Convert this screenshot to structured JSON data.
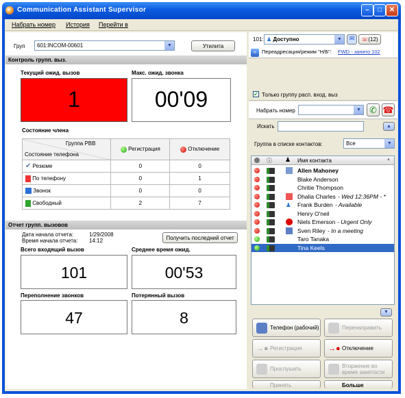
{
  "window": {
    "title": "Communication Assistant Supervisor"
  },
  "menu": [
    "Набрать номер",
    "История",
    "Перейти в"
  ],
  "group": {
    "label": "Груп",
    "value": "601:INCOM-00601",
    "utility_button": "Утилита"
  },
  "sections": {
    "control": "Контроль групп. выз.",
    "report": "Отчет групп. вызовов"
  },
  "current_wait": {
    "label": "Текущий ожид. вызов",
    "value": "1"
  },
  "max_wait": {
    "label": "Макс. ожид. звонка",
    "value": "00'09"
  },
  "member_status": {
    "title": "Состояние члена",
    "header_group": "Группа PBB",
    "header_phone": "Состояние телефона",
    "col_registration": "Регистрация",
    "col_logout": "Отключение",
    "rows": [
      {
        "label": "Резюме",
        "reg": "0",
        "out": "0"
      },
      {
        "label": "По телефону",
        "reg": "0",
        "out": "1"
      },
      {
        "label": "Звонок",
        "reg": "0",
        "out": "0"
      },
      {
        "label": "Свободный",
        "reg": "2",
        "out": "7"
      }
    ]
  },
  "report": {
    "start_date_label": "Дата начала отчета:",
    "start_date": "1/29/2008",
    "start_time_label": "Время начала отчета:",
    "start_time": "14:12",
    "refresh_button": "Получить последний отчет",
    "total_incoming": {
      "label": "Всего входящий вызов",
      "value": "101"
    },
    "avg_wait": {
      "label": "Среднее время ожид.",
      "value": "00'53"
    },
    "overflow": {
      "label": "Переполнение звонков",
      "value": "47"
    },
    "lost": {
      "label": "Потерянный вызов",
      "value": "8"
    }
  },
  "status_panel": {
    "extension": "101:",
    "status": "Доступно",
    "missed_count": "(12)",
    "forward_label": "Переадресация/режим \"Н/Б\":",
    "forward_value": "FWD - занято 102"
  },
  "only_group_checkbox": "Только группу расп. вход. выз",
  "dial": {
    "label": "Набрать номер"
  },
  "search": {
    "label": "Искать"
  },
  "contact_group": {
    "label": "Группа в списке контактов:",
    "value": "Все"
  },
  "contacts_header": "Имя контакта",
  "contacts": [
    {
      "name": "Allen Mahoney",
      "note": "",
      "presence": "red",
      "bold": true,
      "status_icon": "pc-icon"
    },
    {
      "name": "Blake Anderson",
      "note": "",
      "presence": "red",
      "bold": false,
      "status_icon": ""
    },
    {
      "name": "Chritie Thompson",
      "note": "",
      "presence": "red",
      "bold": false,
      "status_icon": ""
    },
    {
      "name": "Dhalia Charles",
      "note": "- Wed 12:36PM - *",
      "presence": "red",
      "bold": false,
      "status_icon": "phone-busy-icon"
    },
    {
      "name": "Frank Burden",
      "note": "- Available",
      "presence": "red",
      "bold": false,
      "status_icon": "person-icon"
    },
    {
      "name": "Henry O'neil",
      "note": "",
      "presence": "red",
      "bold": false,
      "status_icon": ""
    },
    {
      "name": "Niels Emerson",
      "note": "- Urgent Only",
      "presence": "red",
      "bold": false,
      "status_icon": "urgent-icon"
    },
    {
      "name": "Sven Riley",
      "note": "- In a meeting",
      "presence": "red",
      "bold": false,
      "status_icon": "meeting-icon"
    },
    {
      "name": "Taro Tanaka",
      "note": "",
      "presence": "green",
      "bold": false,
      "status_icon": ""
    },
    {
      "name": "Tina Keels",
      "note": "",
      "presence": "green",
      "bold": false,
      "status_icon": "",
      "selected": true
    }
  ],
  "actions": [
    {
      "label": "Телефон (рабочий)",
      "enabled": true
    },
    {
      "label": "Перенаправить",
      "enabled": false
    },
    {
      "label": "Регистрация",
      "enabled": false
    },
    {
      "label": "Отключение",
      "enabled": true
    },
    {
      "label": "Прослушать",
      "enabled": false
    },
    {
      "label": "Вторжение во время занятости",
      "enabled": false
    },
    {
      "label": "Принять",
      "enabled": false
    },
    {
      "label": "Больше",
      "enabled": true
    }
  ],
  "colors": {
    "alert_red": "#ff0000",
    "selection": "#316ac5",
    "title_blue": "#0a52d8"
  }
}
